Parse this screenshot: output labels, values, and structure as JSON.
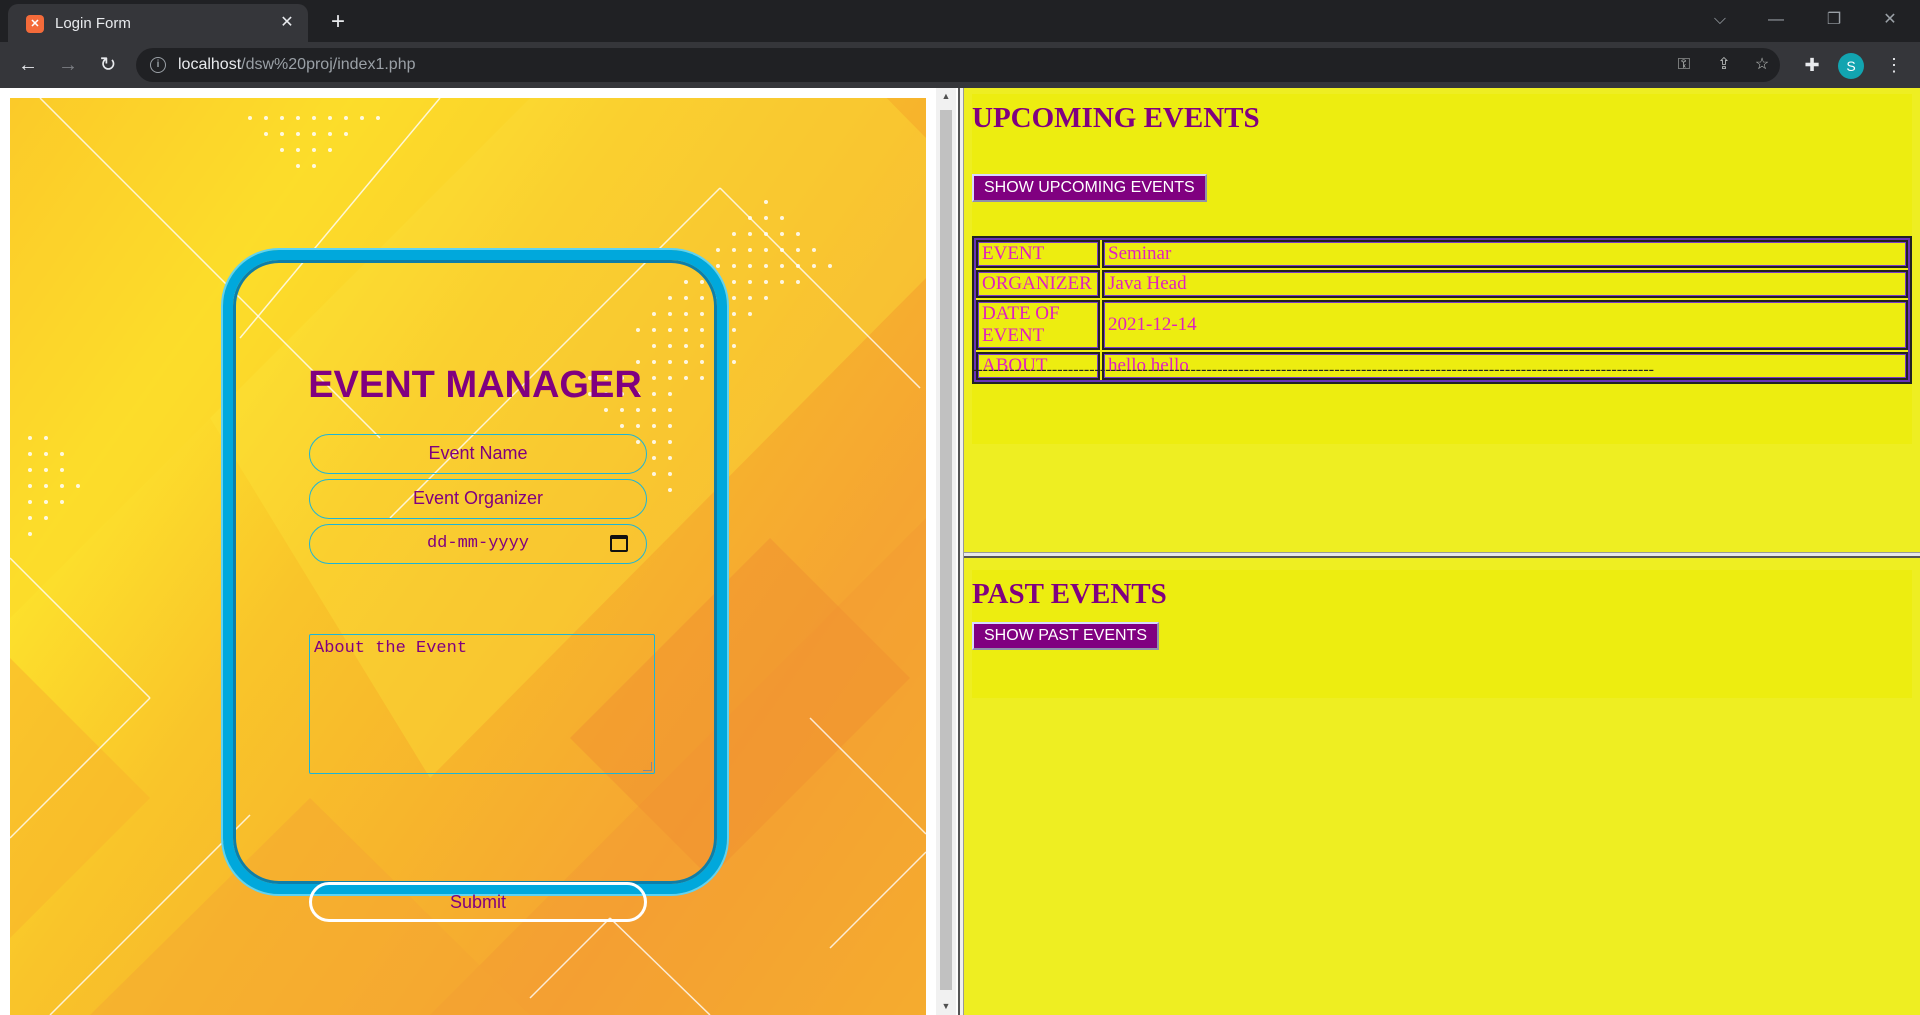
{
  "browser": {
    "tab_title": "Login Form",
    "tab_favicon": "xampp",
    "url_host": "localhost",
    "url_path": "/dsw%20proj/index1.php",
    "profile_initial": "S"
  },
  "form": {
    "title": "EVENT MANAGER",
    "event_name_placeholder": "Event Name",
    "event_organizer_placeholder": "Event Organizer",
    "date_placeholder": "dd-mm-yyyy",
    "about_placeholder": "About the Event",
    "submit_label": "Submit"
  },
  "upcoming": {
    "heading": "UPCOMING EVENTS",
    "button_label": "SHOW UPCOMING EVENTS",
    "rows": [
      {
        "key": "EVENT",
        "value": "Seminar"
      },
      {
        "key": "ORGANIZER",
        "value": "Java Head"
      },
      {
        "key": "DATE OF EVENT",
        "value": "2021-12-14"
      },
      {
        "key": "ABOUT",
        "value": "hello hello"
      }
    ],
    "separator": "--------------------------------------------------------------------------------------------------------------------------------"
  },
  "past": {
    "heading": "PAST EVENTS",
    "button_label": "SHOW PAST EVENTS"
  },
  "colors": {
    "accent_purple": "#800080",
    "panel_yellow": "#eeee22",
    "card_border": "#00a8dc",
    "table_text": "#e020c0"
  }
}
